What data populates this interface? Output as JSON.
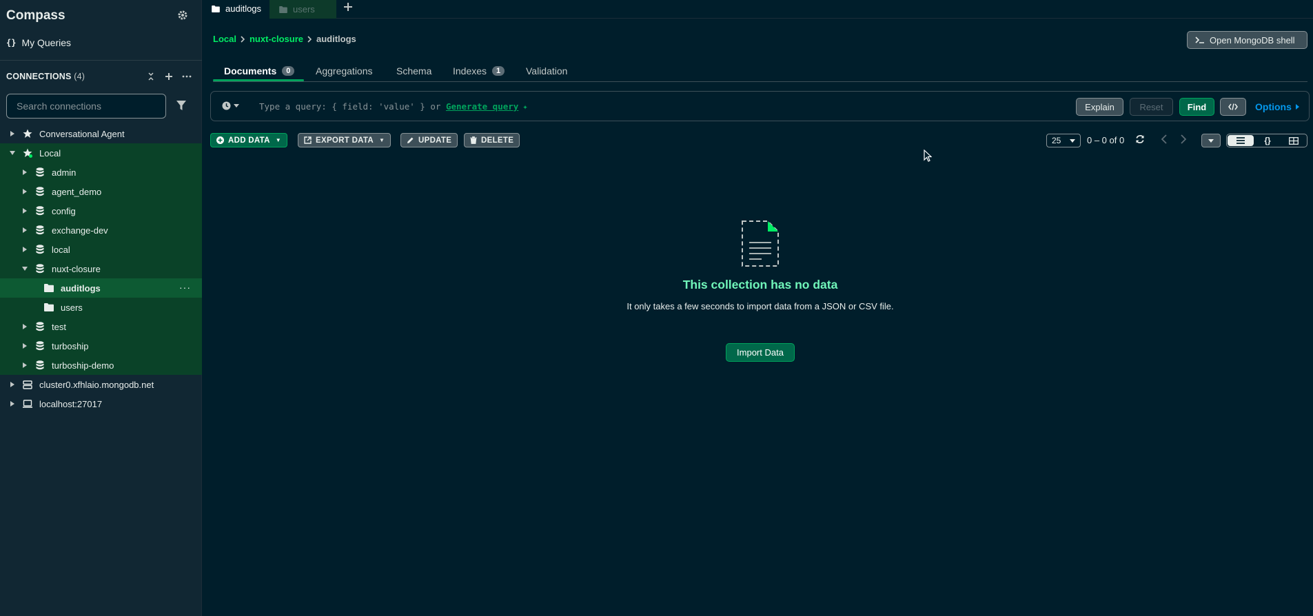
{
  "sidebar": {
    "app_title": "Compass",
    "my_queries": "My Queries",
    "connections_title": "CONNECTIONS",
    "connections_count": "(4)",
    "search_placeholder": "Search connections",
    "tree": [
      {
        "label": "Conversational Agent",
        "icon": "star-icon"
      },
      {
        "label": "Local",
        "icon": "star-icon"
      },
      {
        "label": "admin",
        "icon": "database-icon"
      },
      {
        "label": "agent_demo",
        "icon": "database-icon"
      },
      {
        "label": "config",
        "icon": "database-icon"
      },
      {
        "label": "exchange-dev",
        "icon": "database-icon"
      },
      {
        "label": "local",
        "icon": "database-icon"
      },
      {
        "label": "nuxt-closure",
        "icon": "database-icon"
      },
      {
        "label": "auditlogs",
        "icon": "folder-icon"
      },
      {
        "label": "users",
        "icon": "folder-icon"
      },
      {
        "label": "test",
        "icon": "database-icon"
      },
      {
        "label": "turboship",
        "icon": "database-icon"
      },
      {
        "label": "turboship-demo",
        "icon": "database-icon"
      },
      {
        "label": "cluster0.xfhlaio.mongodb.net",
        "icon": "server-icon"
      },
      {
        "label": "localhost:27017",
        "icon": "laptop-icon"
      }
    ]
  },
  "tabs": [
    {
      "label": "auditlogs"
    },
    {
      "label": "users"
    }
  ],
  "breadcrumb": {
    "connection": "Local",
    "database": "nuxt-closure",
    "collection": "auditlogs"
  },
  "shell_button": "Open MongoDB shell",
  "subtabs": [
    {
      "label": "Documents",
      "badge": "0"
    },
    {
      "label": "Aggregations"
    },
    {
      "label": "Schema"
    },
    {
      "label": "Indexes",
      "badge": "1"
    },
    {
      "label": "Validation"
    }
  ],
  "query": {
    "placeholder_prefix": "Type a query: { field: 'value' } or",
    "generate_link": "Generate query",
    "explain": "Explain",
    "reset": "Reset",
    "find": "Find",
    "options": "Options"
  },
  "toolbar": {
    "add_data": "ADD DATA",
    "export_data": "EXPORT DATA",
    "update": "UPDATE",
    "delete": "DELETE",
    "page_size": "25",
    "range": "0 – 0 of 0"
  },
  "empty_state": {
    "title": "This collection has no data",
    "description": "It only takes a few seconds to import data from a JSON or CSV file.",
    "import_button": "Import Data"
  },
  "colors": {
    "background": "#001e2b",
    "sidebar": "#112733",
    "accent_green": "#00ed64",
    "button_green": "#00684a",
    "link_blue": "#0498ec"
  }
}
